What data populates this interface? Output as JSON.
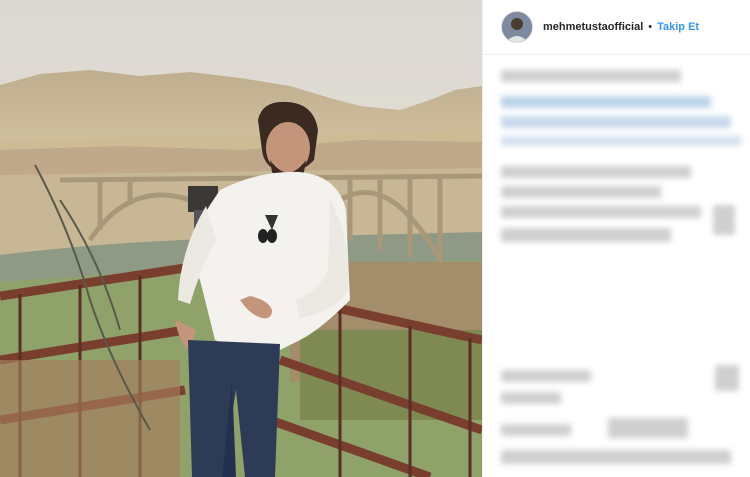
{
  "post": {
    "username": "mehmetustaofficial",
    "separator": "•",
    "follow_label": "Takip Et"
  },
  "colors": {
    "follow": "#3897f0",
    "username": "#262626",
    "blur_primary": "#cfcfcf",
    "blur_accent": "#bcd3ea"
  },
  "icons": {
    "avatar": "profile-avatar-icon"
  }
}
